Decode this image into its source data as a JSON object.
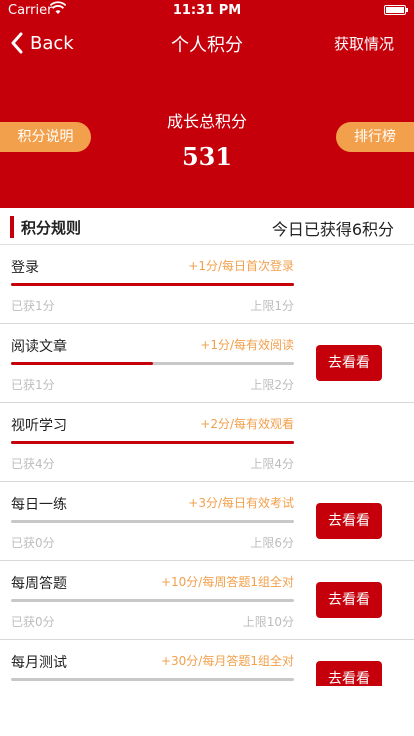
{
  "status_bar": {
    "carrier": "Carrier",
    "time": "11:31 PM"
  },
  "nav": {
    "back_label": "Back",
    "title": "个人积分",
    "right_label": "获取情况"
  },
  "header": {
    "growth_label": "成长总积分",
    "growth_value": "531",
    "explain_label": "积分说明",
    "rank_label": "排行榜"
  },
  "section": {
    "title": "积分规则",
    "today": "今日已获得6积分"
  },
  "colors": {
    "primary": "#c5000b",
    "accent": "#f2a04c"
  },
  "rules": [
    {
      "name": "登录",
      "rule": "+1分/每日首次登录",
      "got": "已获1分",
      "limit": "上限1分",
      "progress": 1.0,
      "action": ""
    },
    {
      "name": "阅读文章",
      "rule": "+1分/每有效阅读",
      "got": "已获1分",
      "limit": "上限2分",
      "progress": 0.5,
      "action": "去看看"
    },
    {
      "name": "视听学习",
      "rule": "+2分/每有效观看",
      "got": "已获4分",
      "limit": "上限4分",
      "progress": 1.0,
      "action": ""
    },
    {
      "name": "每日一练",
      "rule": "+3分/每日有效考试",
      "got": "已获0分",
      "limit": "上限6分",
      "progress": 0.0,
      "action": "去看看"
    },
    {
      "name": "每周答题",
      "rule": "+10分/每周答题1组全对",
      "got": "已获0分",
      "limit": "上限10分",
      "progress": 0.0,
      "action": "去看看"
    },
    {
      "name": "每月测试",
      "rule": "+30分/每月答题1组全对",
      "got": "",
      "limit": "",
      "progress": 0.0,
      "action": "去看看"
    }
  ]
}
